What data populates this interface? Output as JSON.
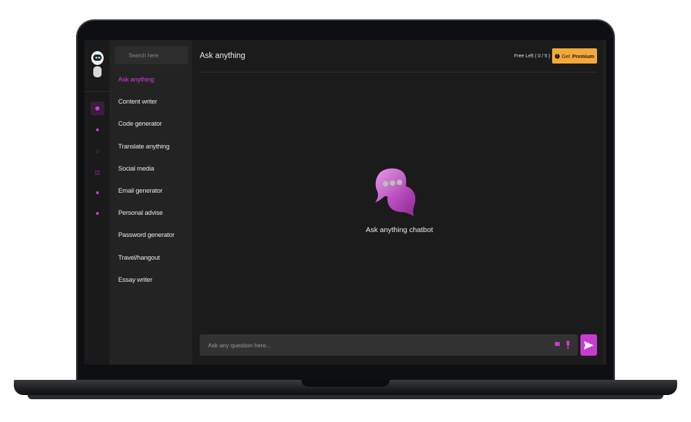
{
  "search": {
    "placeholder": "Search here"
  },
  "menu": {
    "items": [
      {
        "label": "Ask anything"
      },
      {
        "label": "Content writer"
      },
      {
        "label": "Code generator"
      },
      {
        "label": "Translate anything"
      },
      {
        "label": "Social media"
      },
      {
        "label": "Email generator"
      },
      {
        "label": "Personal advise"
      },
      {
        "label": "Password generator"
      },
      {
        "label": "Travel/hangout"
      },
      {
        "label": "Essay writer"
      }
    ],
    "active": "Ask anything"
  },
  "rail_icons": [
    "chat-icon",
    "pen-icon",
    "star-icon",
    "share-icon",
    "mail-icon",
    "user-icon"
  ],
  "header": {
    "title": "Ask anything",
    "free_left": "Free Left ( 0 / 5 )",
    "premium_prefix": "Get",
    "premium_bold": "Premium"
  },
  "empty_state": {
    "caption": "Ask anything chatbot"
  },
  "composer": {
    "placeholder": "Ask any question here..."
  },
  "colors": {
    "accent": "#c73ccf",
    "premium": "#f2a93b",
    "background": "#1b1b1b",
    "sidebar": "#232323"
  }
}
